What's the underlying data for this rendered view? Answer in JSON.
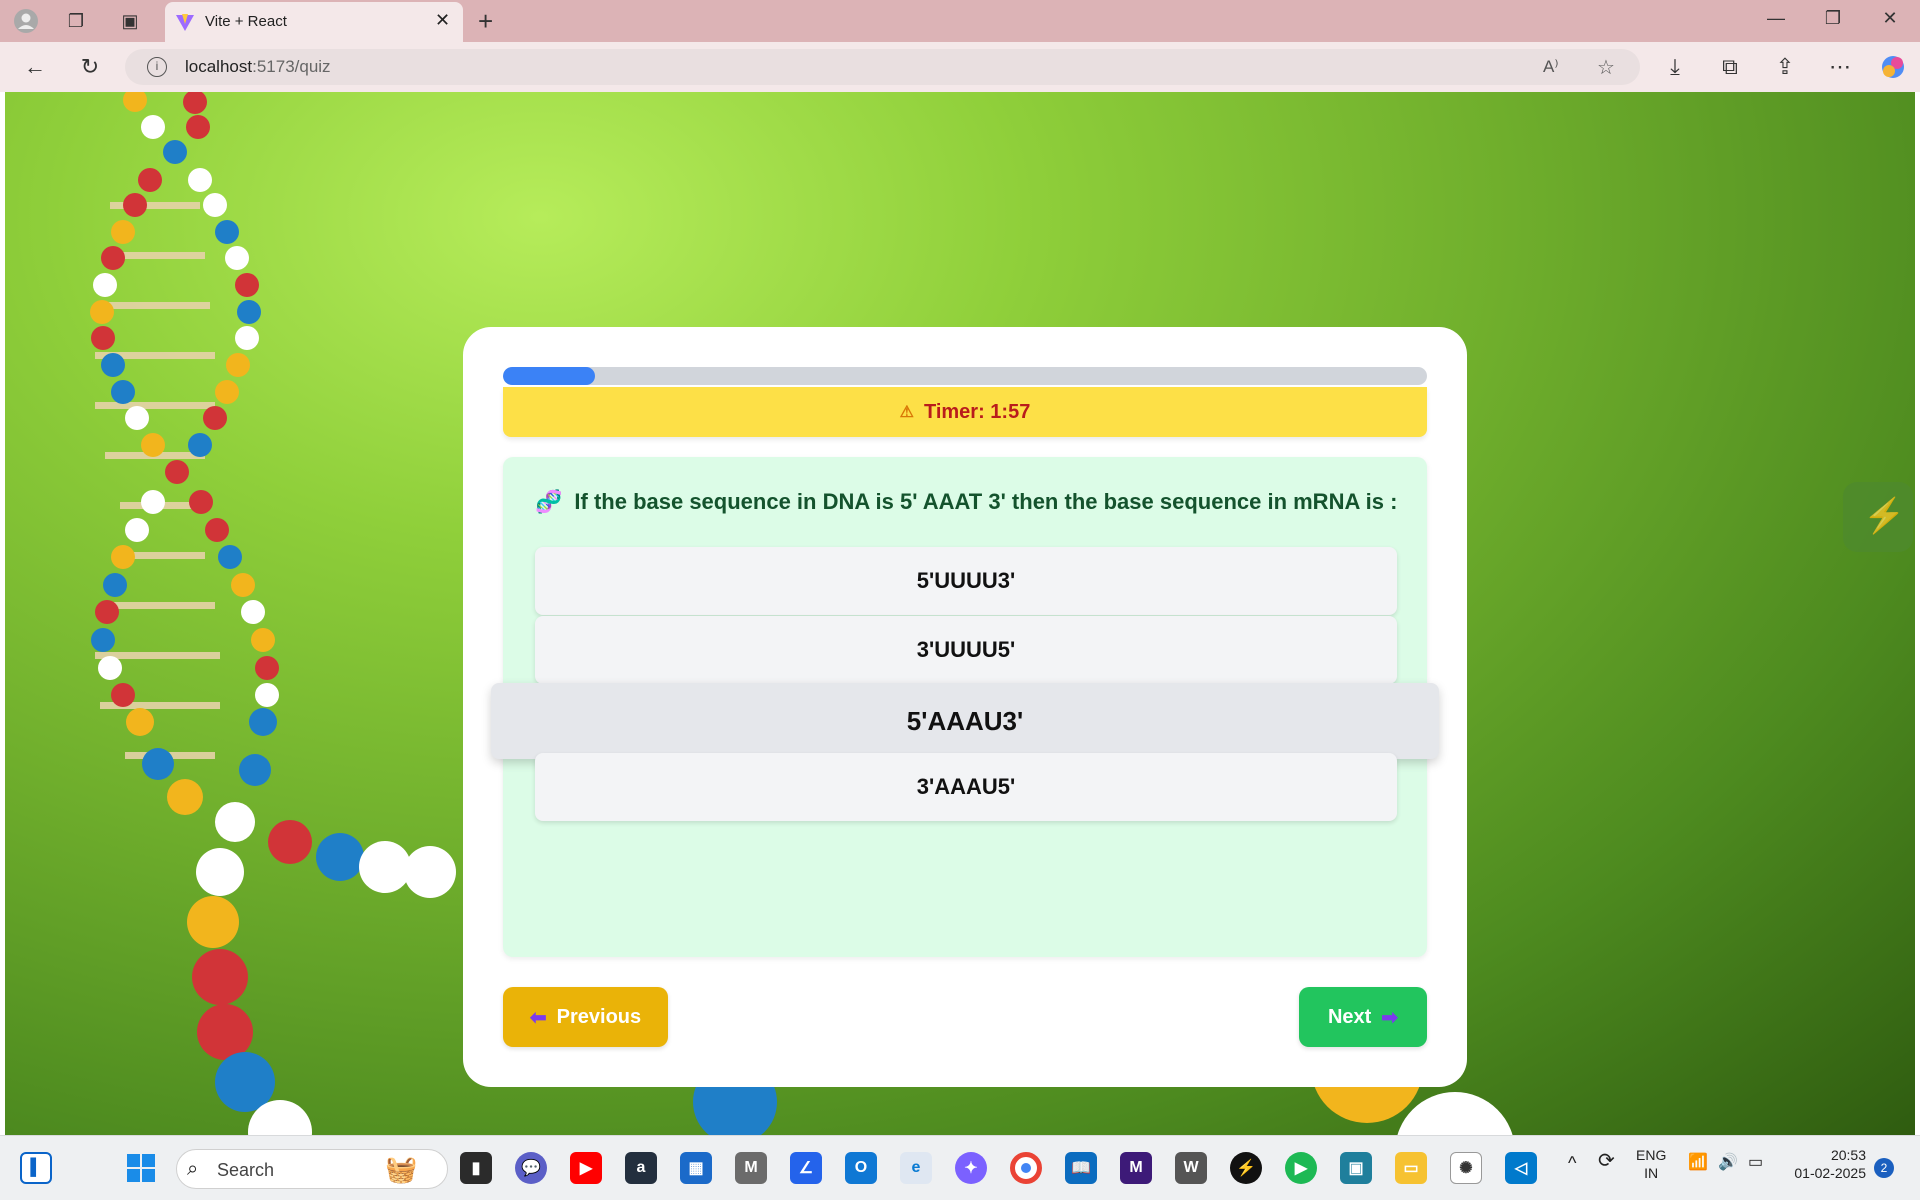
{
  "browser": {
    "tab_title": "Vite + React",
    "url_host": "localhost",
    "url_path": ":5173/quiz",
    "reader_label": "A⁾"
  },
  "quiz": {
    "progress_fraction": 0.1,
    "timer_text": "Timer: 1:57",
    "question": "If the base sequence in DNA is 5' AAAT 3' then the base sequence in mRNA is :",
    "options": [
      "5'UUUU3'",
      "3'UUUU5'",
      "5'AAAU3'",
      "3'AAAU5'"
    ],
    "hovered_option_index": 2,
    "previous_label": "Previous",
    "next_label": "Next"
  },
  "taskbar": {
    "search_placeholder": "Search",
    "lang_top": "ENG",
    "lang_bottom": "IN",
    "time": "20:53",
    "date": "01-02-2025",
    "notification_count": "2"
  }
}
